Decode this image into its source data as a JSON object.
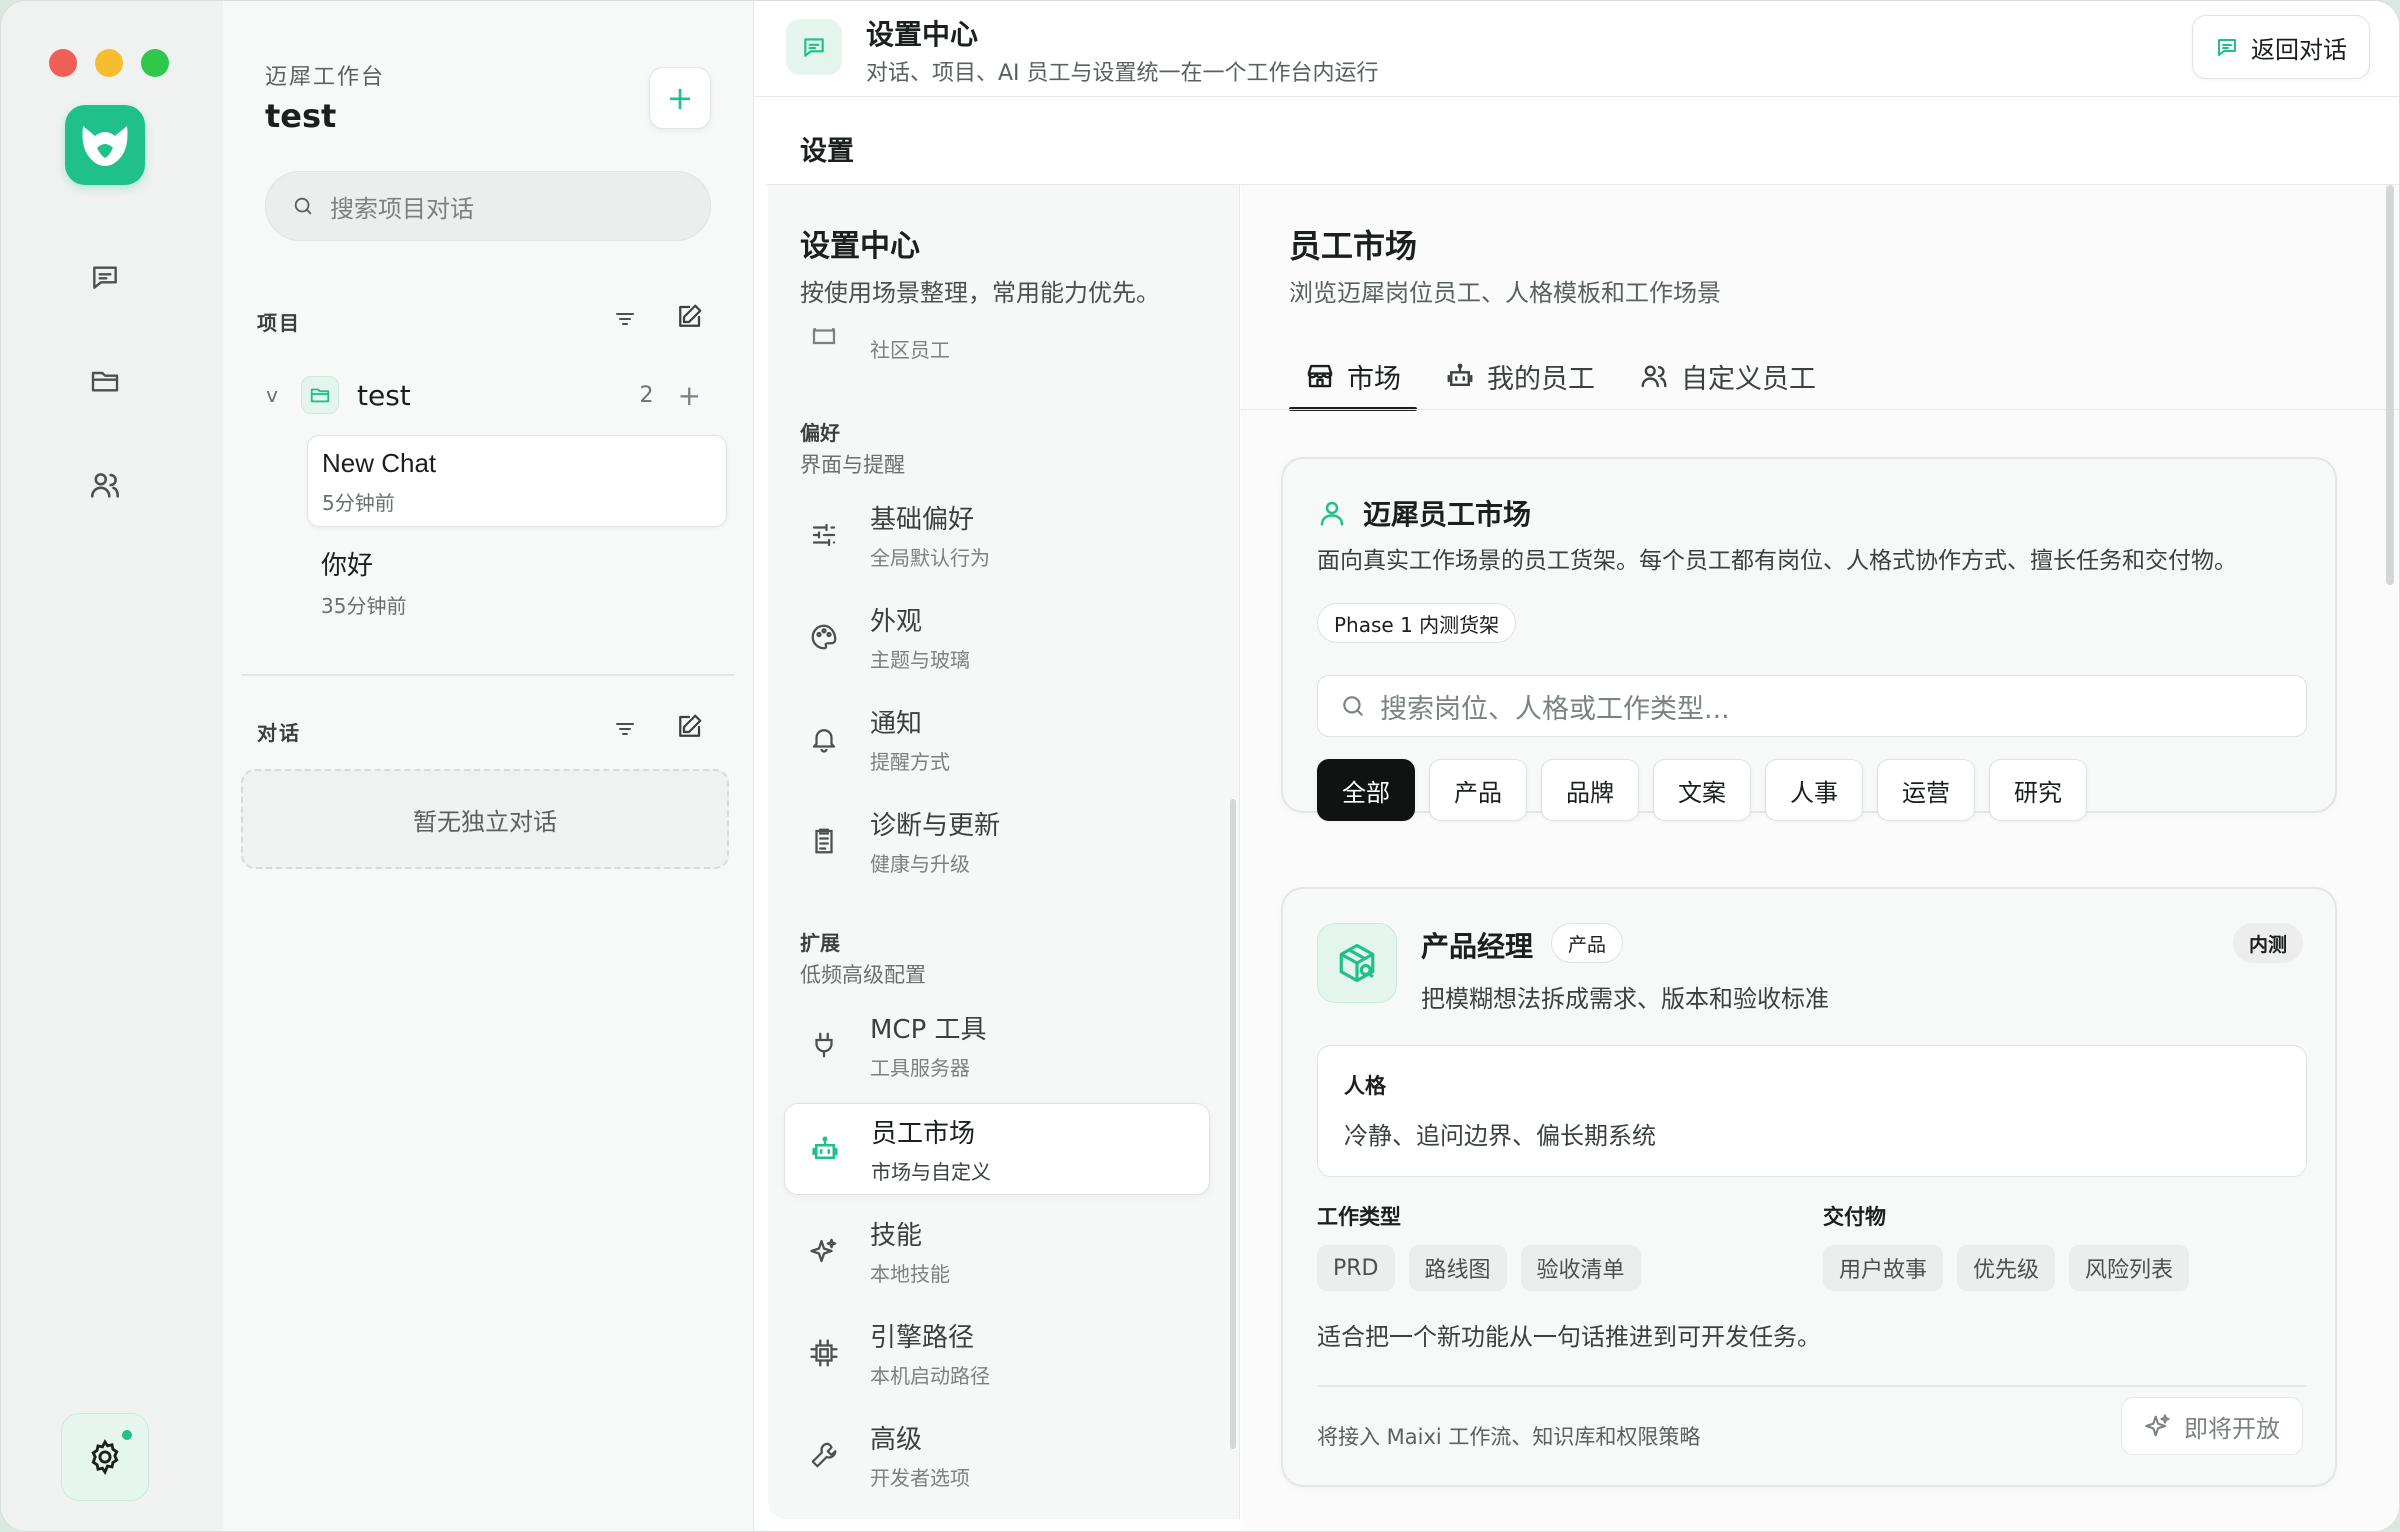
{
  "colors": {
    "accent": "#20c08b",
    "accent_soft": "#e3f5ec",
    "dark_chip": "#111312"
  },
  "rail": {
    "icons": [
      "chat-icon",
      "folder-icon",
      "users-icon"
    ],
    "settings_icon": "gear-icon"
  },
  "workspace": {
    "label": "迈犀工作台",
    "name": "test",
    "search_placeholder": "搜索项目对话"
  },
  "projects_section": {
    "label": "项目",
    "project": {
      "chevron": "v",
      "name": "test",
      "count": "2",
      "plus": "+"
    },
    "chats": [
      {
        "title": "New Chat",
        "time": "5分钟前"
      },
      {
        "title": "你好",
        "time": "35分钟前"
      }
    ]
  },
  "chats_section": {
    "label": "对话",
    "empty": "暂无独立对话"
  },
  "topbar": {
    "title": "设置中心",
    "subtitle": "对话、项目、AI 员工与设置统一在一个工作台内运行",
    "back_label": "返回对话"
  },
  "breadcrumb": "设置",
  "settings_nav": {
    "title": "设置中心",
    "subtitle": "按使用场景整理，常用能力优先。",
    "partial_item": "社区员工",
    "groups": [
      {
        "label": "偏好",
        "sub": "界面与提醒",
        "items": [
          {
            "title": "基础偏好",
            "sub": "全局默认行为",
            "icon": "sliders-icon"
          },
          {
            "title": "外观",
            "sub": "主题与玻璃",
            "icon": "palette-icon"
          },
          {
            "title": "通知",
            "sub": "提醒方式",
            "icon": "bell-icon"
          },
          {
            "title": "诊断与更新",
            "sub": "健康与升级",
            "icon": "clipboard-icon"
          }
        ]
      },
      {
        "label": "扩展",
        "sub": "低频高级配置",
        "items": [
          {
            "title": "MCP 工具",
            "sub": "工具服务器",
            "icon": "plug-icon"
          },
          {
            "title": "员工市场",
            "sub": "市场与自定义",
            "icon": "robot-icon"
          },
          {
            "title": "技能",
            "sub": "本地技能",
            "icon": "sparkle-icon"
          },
          {
            "title": "引擎路径",
            "sub": "本机启动路径",
            "icon": "chip-icon"
          },
          {
            "title": "高级",
            "sub": "开发者选项",
            "icon": "wrench-icon"
          }
        ]
      }
    ]
  },
  "content": {
    "title": "员工市场",
    "subtitle": "浏览迈犀岗位员工、人格模板和工作场景",
    "tabs": [
      {
        "label": "市场",
        "icon": "store-icon"
      },
      {
        "label": "我的员工",
        "icon": "robot-icon"
      },
      {
        "label": "自定义员工",
        "icon": "users-icon"
      }
    ],
    "market": {
      "title": "迈犀员工市场",
      "desc": "面向真实工作场景的员工货架。每个员工都有岗位、人格式协作方式、擅长任务和交付物。",
      "phase_tag": "Phase 1 内测货架",
      "search_placeholder": "搜索岗位、人格或工作类型...",
      "chips": [
        "全部",
        "产品",
        "品牌",
        "文案",
        "人事",
        "运营",
        "研究"
      ]
    },
    "employee": {
      "name": "产品经理",
      "category": "产品",
      "badge": "内测",
      "desc": "把模糊想法拆成需求、版本和验收标准",
      "persona_label": "人格",
      "persona_value": "冷静、追问边界、偏长期系统",
      "work_label": "工作类型",
      "work_types": [
        "PRD",
        "路线图",
        "验收清单"
      ],
      "deliver_label": "交付物",
      "deliverables": [
        "用户故事",
        "优先级",
        "风险列表"
      ],
      "note": "适合把一个新功能从一句话推进到可开发任务。",
      "footer": "将接入 Maixi 工作流、知识库和权限策略",
      "soon_label": "即将开放"
    }
  }
}
